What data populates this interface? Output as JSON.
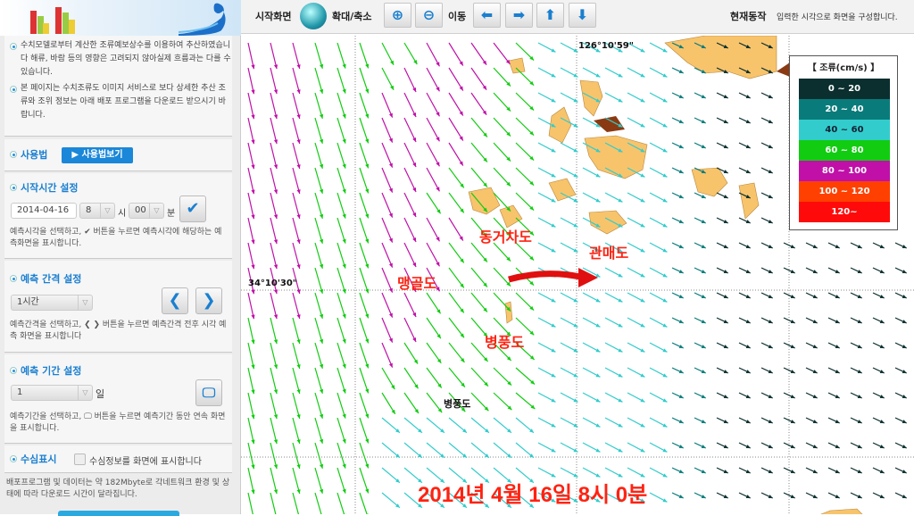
{
  "sidebar": {
    "notes": [
      "수치모델로부터 계산한 조류예보상수를 이용하여 추산하였습니다 해류, 바람 등의 영향은 고려되지 않아실제 흐름과는 다를 수 있습니다.",
      "본 페이지는 수치조류도 이미지 서비스로 보다 상세한 추산 조류와 조위 정보는 아래 배포 프로그램을 다운로드 받으시기 바랍니다."
    ],
    "usage": {
      "title": "사용법",
      "button": "▶ 사용법보기"
    },
    "start": {
      "title": "시작시간 설정",
      "date": "2014-04-16",
      "hour": "8",
      "hour_unit": "시",
      "minute": "00",
      "minute_unit": "분",
      "help": "예측시각을 선택하고, ✔ 버튼을 누르면 예측시각에 해당하는 예측화면을 표시합니다."
    },
    "interval": {
      "title": "예측 간격 설정",
      "value": "1시간",
      "help": "예측간격을 선택하고, ❮ ❯ 버튼을 누르면 예측간격 전후 시각 예측 화면을 표시합니다"
    },
    "period": {
      "title": "예측 기간 설정",
      "value": "1",
      "unit": "일",
      "help": "예측기간을 선택하고, 🖵 버튼을 누르면 예측기간 동안 연속 화면을 표시합니다."
    },
    "depth": {
      "title": "수심표시",
      "checkbox_label": "수심정보를 화면에 표시합니다",
      "checked": false
    },
    "download_note": "배포프로그램 및 데이터는 약 182Mbyte로 각네트워크 환경 및 상태에 따라 다운로드 시간이 달라집니다."
  },
  "toolbar": {
    "home": "시작화면",
    "zoom": "확대/축소",
    "move": "이동",
    "status_label": "현재동작",
    "status_text": "입력한 시각으로 화면을 구성합니다."
  },
  "map": {
    "lon_label": "126°10'59\"",
    "lat_label": "34°10'30\"",
    "places": {
      "donggeochado": "동거차도",
      "gwanmaedo": "관매도",
      "maenggoldo": "맹골도",
      "byeongpungdo": "병풍도",
      "byeongpungdo_black": "병풍도"
    },
    "timestamp": "2014년 4월 16일 8시 0분",
    "legend": {
      "title": "【 조류(cm/s) 】",
      "rows": [
        {
          "label": "0 ~      20",
          "color": "#0b2e2e",
          "text": "#fff"
        },
        {
          "label": "20 ~      40",
          "color": "#0a7b7b",
          "text": "#fff"
        },
        {
          "label": "40 ~      60",
          "color": "#33cccc",
          "text": "#123"
        },
        {
          "label": "60 ~      80",
          "color": "#11cc11",
          "text": "#fff"
        },
        {
          "label": "80 ~     100",
          "color": "#c010a8",
          "text": "#fff"
        },
        {
          "label": "100 ~     120",
          "color": "#ff4000",
          "text": "#fff"
        },
        {
          "label": "120~",
          "color": "#ff0a0a",
          "text": "#fff"
        }
      ]
    }
  }
}
